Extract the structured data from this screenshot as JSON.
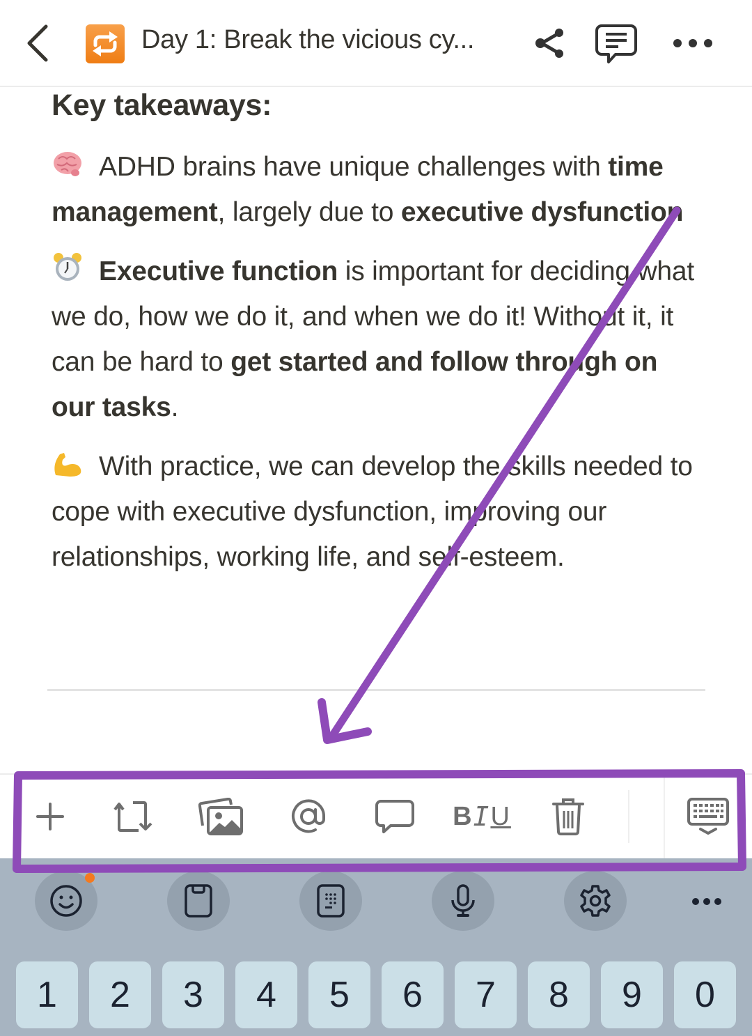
{
  "header": {
    "title": "Day 1: Break the vicious cy...",
    "page_icon": "repeat-arrows-icon",
    "back_icon": "chevron-left-icon",
    "actions": [
      "share-icon",
      "comment-icon",
      "more-icon"
    ]
  },
  "content": {
    "heading": "Key takeaways:",
    "paragraphs": [
      {
        "emoji": "brain",
        "segments": [
          {
            "text": "ADHD brains have unique challenges with ",
            "bold": false
          },
          {
            "text": "time management",
            "bold": true
          },
          {
            "text": ", largely due to ",
            "bold": false
          },
          {
            "text": "executive dysfunction",
            "bold": true
          }
        ]
      },
      {
        "emoji": "alarm-clock",
        "segments": [
          {
            "text": "Executive function",
            "bold": true
          },
          {
            "text": " is important for deciding what we do, how we do it, and when we do it! Without it, it can be hard to ",
            "bold": false
          },
          {
            "text": "get started and follow through on our tasks",
            "bold": true
          },
          {
            "text": ".",
            "bold": false
          }
        ]
      },
      {
        "emoji": "flexed-biceps",
        "segments": [
          {
            "text": "With practice, we can develop the skills needed to cope with executive dysfunction, improving our relationships, working life, and self-esteem.",
            "bold": false
          }
        ]
      }
    ]
  },
  "toolbar": {
    "items": [
      {
        "name": "add",
        "icon": "plus-icon"
      },
      {
        "name": "turn-into",
        "icon": "turn-into-icon"
      },
      {
        "name": "image",
        "icon": "image-icon"
      },
      {
        "name": "mention",
        "icon": "at-icon"
      },
      {
        "name": "comment",
        "icon": "comment-bubble-icon"
      },
      {
        "name": "text-style",
        "icon": "biu-icon",
        "label_b": "B",
        "label_i": "I",
        "label_u": "U"
      },
      {
        "name": "delete",
        "icon": "trash-icon"
      },
      {
        "name": "hide-keyboard",
        "icon": "keyboard-hide-icon"
      }
    ]
  },
  "keyboard": {
    "tools": [
      "emoji-icon",
      "clipboard-icon",
      "keypad-icon",
      "microphone-icon",
      "settings-icon",
      "more-icon"
    ],
    "number_keys": [
      "1",
      "2",
      "3",
      "4",
      "5",
      "6",
      "7",
      "8",
      "9",
      "0"
    ]
  },
  "colors": {
    "annotation": "#8e4bb8",
    "page_icon": "#f08a26",
    "text": "#37352f",
    "icon_gray": "#6e6e6e",
    "keyboard_bg": "#a7b4c1",
    "key_bg": "#cbdfe7",
    "badge": "#f47a1f"
  }
}
